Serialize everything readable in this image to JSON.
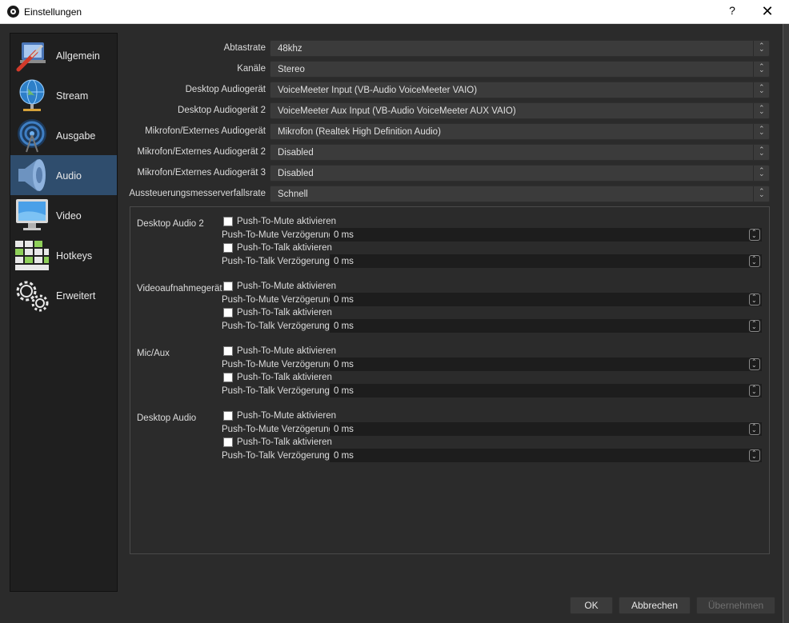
{
  "window": {
    "title": "Einstellungen",
    "help_glyph": "?",
    "close_glyph": "✕"
  },
  "sidebar": {
    "items": [
      {
        "label": "Allgemein",
        "icon": "wrench-screwdriver-icon"
      },
      {
        "label": "Stream",
        "icon": "globe-network-icon"
      },
      {
        "label": "Ausgabe",
        "icon": "broadcast-antenna-icon"
      },
      {
        "label": "Audio",
        "icon": "speaker-icon",
        "selected": true
      },
      {
        "label": "Video",
        "icon": "monitor-icon"
      },
      {
        "label": "Hotkeys",
        "icon": "keyboard-icon"
      },
      {
        "label": "Erweitert",
        "icon": "gears-icon"
      }
    ]
  },
  "audio_settings": [
    {
      "label": "Abtastrate",
      "value": "48khz"
    },
    {
      "label": "Kanäle",
      "value": "Stereo"
    },
    {
      "label": "Desktop Audiogerät",
      "value": "VoiceMeeter Input (VB-Audio VoiceMeeter VAIO)"
    },
    {
      "label": "Desktop Audiogerät 2",
      "value": "VoiceMeeter Aux Input (VB-Audio VoiceMeeter AUX VAIO)"
    },
    {
      "label": "Mikrofon/Externes Audiogerät",
      "value": "Mikrofon (Realtek High Definition Audio)"
    },
    {
      "label": "Mikrofon/Externes Audiogerät 2",
      "value": "Disabled"
    },
    {
      "label": "Mikrofon/Externes Audiogerät 3",
      "value": "Disabled"
    },
    {
      "label": "Aussteuerungsmesserverfallsrate",
      "value": "Schnell"
    }
  ],
  "hotkey_devices": [
    {
      "name": "Desktop Audio 2",
      "ptm_label": "Push-To-Mute aktivieren",
      "ptm_checked": false,
      "ptm_delay_label": "Push-To-Mute Verzögerung",
      "ptm_delay": "0 ms",
      "ptt_label": "Push-To-Talk aktivieren",
      "ptt_checked": false,
      "ptt_delay_label": "Push-To-Talk Verzögerung",
      "ptt_delay": "0 ms"
    },
    {
      "name": "Videoaufnahmegerät",
      "ptm_label": "Push-To-Mute aktivieren",
      "ptm_checked": false,
      "ptm_delay_label": "Push-To-Mute Verzögerung",
      "ptm_delay": "0 ms",
      "ptt_label": "Push-To-Talk aktivieren",
      "ptt_checked": false,
      "ptt_delay_label": "Push-To-Talk Verzögerung",
      "ptt_delay": "0 ms"
    },
    {
      "name": "Mic/Aux",
      "ptm_label": "Push-To-Mute aktivieren",
      "ptm_checked": false,
      "ptm_delay_label": "Push-To-Mute Verzögerung",
      "ptm_delay": "0 ms",
      "ptt_label": "Push-To-Talk aktivieren",
      "ptt_checked": false,
      "ptt_delay_label": "Push-To-Talk Verzögerung",
      "ptt_delay": "0 ms"
    },
    {
      "name": "Desktop Audio",
      "ptm_label": "Push-To-Mute aktivieren",
      "ptm_checked": false,
      "ptm_delay_label": "Push-To-Mute Verzögerung",
      "ptm_delay": "0 ms",
      "ptt_label": "Push-To-Talk aktivieren",
      "ptt_checked": false,
      "ptt_delay_label": "Push-To-Talk Verzögerung",
      "ptt_delay": "0 ms"
    }
  ],
  "footer": {
    "ok_label": "OK",
    "cancel_label": "Abbrechen",
    "apply_label": "Übernehmen",
    "apply_enabled": false
  },
  "colors": {
    "background": "#2b2b2b",
    "sidebar_selected": "#2f4d6d",
    "input_background": "#1d1d1d"
  }
}
